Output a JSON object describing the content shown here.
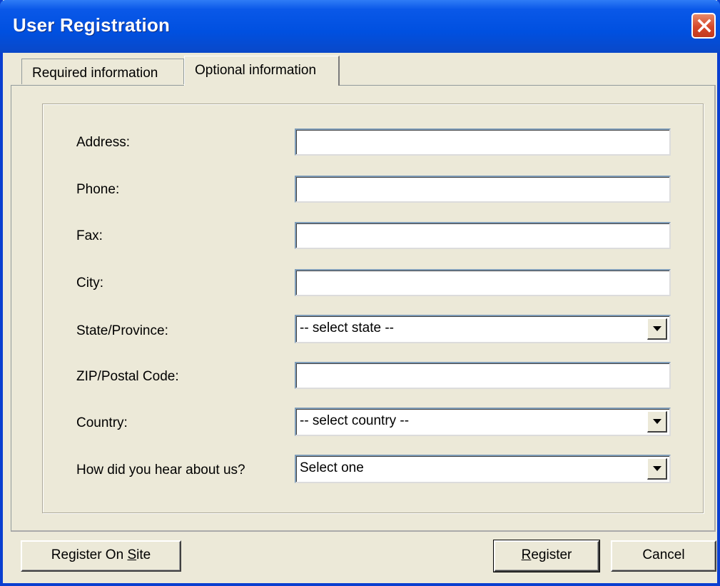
{
  "window": {
    "title": "User Registration"
  },
  "tabs": [
    {
      "label": "Required information"
    },
    {
      "label": "Optional information"
    }
  ],
  "form": {
    "address_label": "Address:",
    "address_value": "",
    "phone_label": "Phone:",
    "phone_value": "",
    "fax_label": "Fax:",
    "fax_value": "",
    "city_label": "City:",
    "city_value": "",
    "state_label": "State/Province:",
    "state_selected": "-- select state --",
    "zip_label": "ZIP/Postal Code:",
    "zip_value": "",
    "country_label": "Country:",
    "country_selected": "-- select country --",
    "hear_label": "How did you hear about us?",
    "hear_selected": "Select one"
  },
  "buttons": {
    "register_on_site_prefix": "Register On ",
    "register_on_site_mnemonic": "S",
    "register_on_site_suffix": "ite",
    "register_mnemonic": "R",
    "register_suffix": "egister",
    "cancel": "Cancel"
  },
  "colors": {
    "titlebar": "#0054e3",
    "dialog_bg": "#ece9d8",
    "close_button": "#d6482a"
  }
}
